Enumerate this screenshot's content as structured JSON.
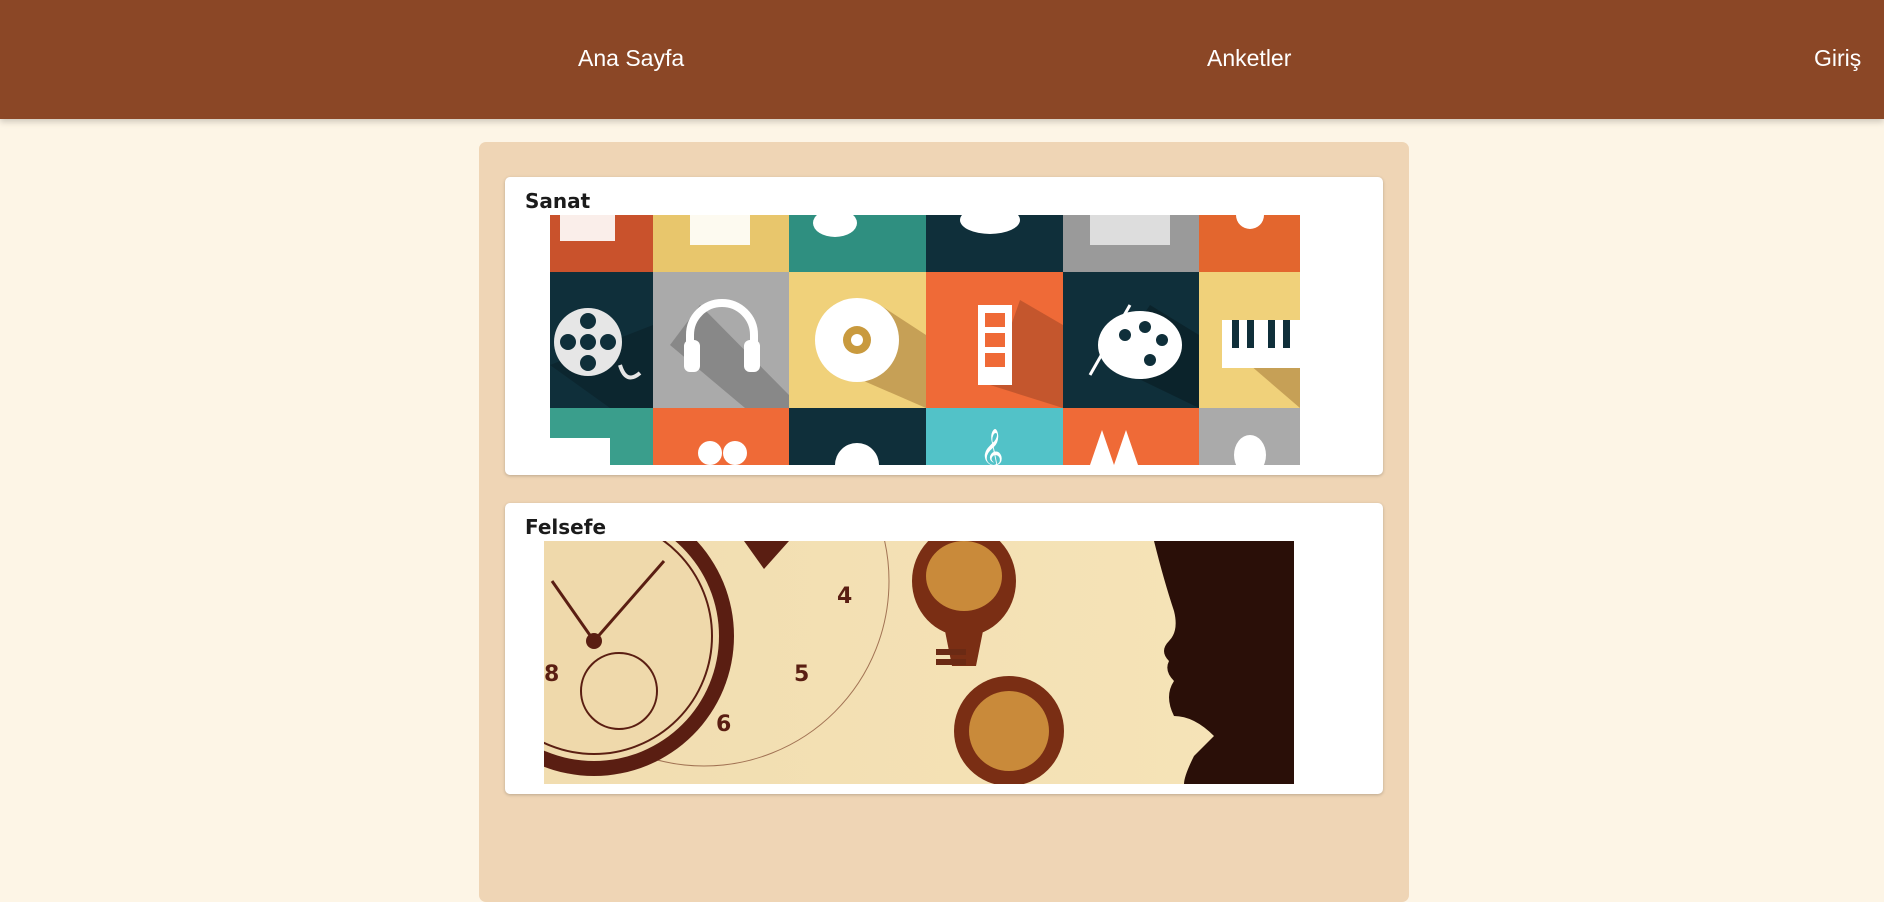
{
  "nav": {
    "home_label": "Ana Sayfa",
    "surveys_label": "Anketler",
    "login_label": "Giriş"
  },
  "categories": [
    {
      "title": "Sanat",
      "image_icon": "art-icons-collage-image"
    },
    {
      "title": "Felsefe",
      "image_icon": "philosophy-clock-brain-image"
    }
  ],
  "colors": {
    "topbar": "#8b4726",
    "page_background": "#fdf5e6",
    "panel_background": "#efd5b5",
    "card_background": "#ffffff"
  }
}
